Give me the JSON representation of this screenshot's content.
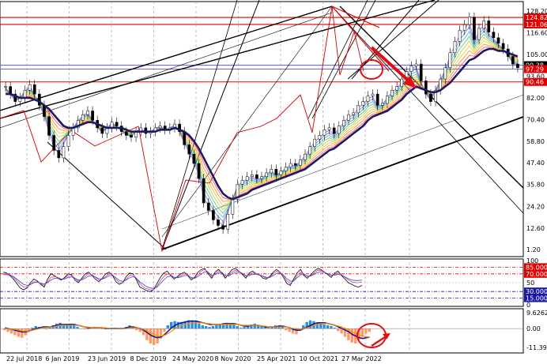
{
  "chart_data": [
    {
      "type": "candlestick",
      "title": "",
      "price_ticks": [
        "128.20",
        "116.60",
        "105.00",
        "93.60",
        "82.00",
        "70.40",
        "58.80",
        "47.40",
        "35.80",
        "24.20",
        "12.60",
        "1.20"
      ],
      "price_range": [
        1.2,
        128.2
      ],
      "tags": [
        {
          "label": "124.82",
          "value": 124.82,
          "color": "#e00000"
        },
        {
          "label": "121.06",
          "value": 121.06,
          "color": "#e00000"
        },
        {
          "label": "99.38",
          "value": 99.38,
          "color": "#000000"
        },
        {
          "label": "97.29",
          "value": 97.29,
          "color": "#e00000"
        },
        {
          "label": "90.46",
          "value": 90.46,
          "color": "#e00000"
        }
      ],
      "horizontal_lines": [
        {
          "value": 124.82,
          "color": "#e00000"
        },
        {
          "value": 121.06,
          "color": "#e00000"
        },
        {
          "value": 99.38,
          "color": "#6a6ad8"
        },
        {
          "value": 97.29,
          "color": "#6a6ad8"
        },
        {
          "value": 90.46,
          "color": "#e00000"
        }
      ],
      "series": [
        {
          "name": "",
          "type": "candles",
          "values": [
            88,
            84,
            80,
            82,
            86,
            89,
            84,
            78,
            72,
            62,
            54,
            50,
            56,
            62,
            66,
            70,
            73,
            75,
            70,
            66,
            63,
            66,
            69,
            67,
            64,
            62,
            61,
            64,
            66,
            63,
            64,
            66,
            67,
            65,
            66,
            68,
            64,
            57,
            52,
            47,
            39,
            26,
            22,
            17,
            14,
            12,
            20,
            28,
            36,
            38,
            40,
            41,
            39,
            40,
            42,
            44,
            41,
            43,
            45,
            47,
            46,
            49,
            52,
            56,
            60,
            62,
            65,
            66,
            63,
            67,
            70,
            73,
            74,
            78,
            80,
            83,
            84,
            78,
            79,
            83,
            86,
            88,
            92,
            96,
            99,
            100,
            91,
            84,
            80,
            86,
            92,
            98,
            106,
            112,
            118,
            121,
            125,
            113,
            119,
            123,
            117,
            114,
            111,
            108,
            104,
            100,
            98
          ]
        },
        {
          "name": "",
          "type": "moving-average",
          "color": "#1a1a6a",
          "values": [
            84,
            84,
            83,
            82,
            82,
            82,
            81,
            80,
            78,
            76,
            73,
            70,
            67,
            66,
            66,
            67,
            68,
            69,
            69,
            68,
            67,
            66,
            66,
            66,
            66,
            65,
            64,
            64,
            64,
            64,
            64,
            64,
            65,
            65,
            65,
            66,
            65,
            64,
            62,
            59,
            55,
            50,
            45,
            40,
            35,
            31,
            29,
            28,
            29,
            30,
            31,
            33,
            34,
            35,
            36,
            37,
            38,
            39,
            40,
            41,
            42,
            43,
            44,
            46,
            48,
            50,
            52,
            54,
            55,
            57,
            59,
            61,
            63,
            65,
            67,
            70,
            72,
            73,
            74,
            75,
            77,
            79,
            81,
            84,
            86,
            88,
            87,
            86,
            85,
            85,
            86,
            88,
            90,
            93,
            96,
            99,
            102,
            103,
            105,
            107,
            108,
            108,
            107,
            107,
            106,
            105,
            104
          ]
        }
      ]
    },
    {
      "type": "line",
      "title": "",
      "y_ticks": [
        "100",
        "85.0000",
        "70.0000",
        "50",
        "30.0000",
        "15.0000",
        "0"
      ],
      "y_range": [
        0,
        100
      ],
      "levels": [
        {
          "label": "85.0000",
          "value": 85,
          "color": "#e00000"
        },
        {
          "label": "70.0000",
          "value": 70,
          "color": "#e00000"
        },
        {
          "label": "30.0000",
          "value": 30,
          "color": "#1a1aa0"
        },
        {
          "label": "15.0000",
          "value": 15,
          "color": "#1a1aa0"
        }
      ],
      "series": [
        {
          "name": "",
          "color": "#000000",
          "values": [
            74,
            72,
            66,
            58,
            48,
            38,
            34,
            38,
            50,
            58,
            54,
            46,
            40,
            58,
            70,
            66,
            60,
            56,
            62,
            70,
            68,
            56,
            50,
            60,
            70,
            74,
            66,
            58,
            52,
            60,
            70,
            74,
            66,
            52,
            46,
            50,
            64,
            72,
            70,
            56,
            40,
            36,
            32,
            30,
            34,
            48,
            62,
            72,
            76,
            66,
            58,
            64,
            70,
            74,
            66,
            56,
            62,
            74,
            80,
            82,
            70,
            60,
            74,
            80,
            72,
            60,
            70,
            80,
            82,
            76,
            68,
            60,
            72,
            76,
            70,
            68,
            60,
            58,
            64,
            74,
            80,
            74,
            62,
            48,
            44,
            58,
            72,
            80,
            66,
            60,
            68,
            76,
            82,
            80,
            74,
            68,
            62,
            72,
            76,
            66,
            58,
            50,
            46,
            42,
            40,
            44
          ]
        },
        {
          "name": "",
          "color": "#d04090",
          "values": [
            70,
            70,
            68,
            62,
            54,
            46,
            40,
            40,
            46,
            52,
            52,
            48,
            44,
            52,
            62,
            64,
            62,
            58,
            60,
            66,
            66,
            60,
            54,
            58,
            64,
            70,
            68,
            62,
            56,
            58,
            64,
            70,
            68,
            58,
            50,
            50,
            58,
            66,
            68,
            60,
            48,
            40,
            36,
            34,
            34,
            42,
            54,
            64,
            70,
            68,
            62,
            62,
            66,
            70,
            68,
            60,
            60,
            68,
            76,
            80,
            74,
            64,
            70,
            76,
            74,
            64,
            66,
            74,
            78,
            76,
            70,
            64,
            68,
            72,
            70,
            68,
            64,
            60,
            62,
            70,
            76,
            74,
            66,
            54,
            48,
            54,
            66,
            74,
            70,
            64,
            66,
            72,
            78,
            78,
            74,
            70,
            66,
            68,
            72,
            68,
            62,
            56,
            52,
            50,
            50,
            52
          ]
        },
        {
          "name": "",
          "color": "#4040d0",
          "values": [
            68,
            68,
            67,
            64,
            58,
            52,
            46,
            44,
            46,
            50,
            51,
            49,
            47,
            50,
            56,
            60,
            60,
            58,
            58,
            62,
            63,
            60,
            56,
            56,
            60,
            65,
            66,
            63,
            59,
            58,
            61,
            66,
            66,
            61,
            55,
            53,
            56,
            61,
            64,
            60,
            52,
            46,
            41,
            38,
            37,
            40,
            48,
            56,
            63,
            65,
            62,
            61,
            63,
            66,
            66,
            62,
            60,
            64,
            70,
            75,
            73,
            67,
            68,
            72,
            72,
            67,
            65,
            70,
            74,
            74,
            71,
            66,
            66,
            69,
            69,
            67,
            65,
            62,
            62,
            66,
            71,
            72,
            67,
            59,
            53,
            54,
            61,
            68,
            68,
            65,
            65,
            69,
            73,
            75,
            73,
            70,
            67,
            67,
            69,
            67,
            63,
            59,
            56,
            55,
            55,
            56
          ]
        }
      ]
    },
    {
      "type": "histogram",
      "title": "",
      "y_ticks": [
        "9.6262",
        "0.00",
        "-11.3976"
      ],
      "y_range": [
        -11.3976,
        9.6262
      ],
      "dates": [
        "22 Jul 2018",
        "6 Jan 2019",
        "23 Jun 2019",
        "8 Dec 2019",
        "24 May 2020",
        "8 Nov 2020",
        "25 Apr 2021",
        "10 Oct 2021",
        "27 Mar 2022"
      ],
      "series": [
        {
          "name": "",
          "type": "bars",
          "values": [
            -1,
            -2,
            -3,
            -4,
            -5,
            -5.5,
            -4,
            -2,
            0.5,
            1.5,
            1,
            0.5,
            -0.5,
            1,
            2,
            3,
            3.5,
            2.5,
            2,
            3,
            2.5,
            1,
            0,
            -0.5,
            -0.5,
            0.5,
            1,
            0.5,
            0,
            -0.5,
            0,
            0.5,
            0.5,
            0,
            0,
            1,
            2,
            1,
            -1,
            -2,
            -4,
            -7,
            -9,
            -10,
            -9,
            -6,
            -2,
            2,
            4,
            4.5,
            4,
            4,
            4.5,
            5,
            5,
            4.5,
            3,
            2,
            1.5,
            1,
            1.5,
            2,
            2.5,
            3,
            3.5,
            3,
            2.5,
            1.5,
            0.5,
            1,
            2,
            2.5,
            3,
            2,
            1.5,
            1,
            0.5,
            1,
            2,
            2,
            1,
            -1,
            -2,
            -3,
            -3.5,
            -1,
            2,
            4,
            5,
            4.5,
            3.5,
            3,
            2.5,
            2,
            1.5,
            0.5,
            -1.5,
            -3,
            -5,
            -7,
            -8.5,
            -9,
            -7,
            -5,
            -3,
            -2
          ]
        },
        {
          "name": "",
          "type": "line",
          "color": "#1a1a8a",
          "values": [
            0.5,
            0,
            -0.5,
            -1,
            -1.5,
            -2,
            -2,
            -1.5,
            -0.5,
            0,
            0.5,
            1,
            1,
            1,
            1.5,
            2,
            2.5,
            2.5,
            2.5,
            2.5,
            2.5,
            2,
            1.5,
            1,
            0.5,
            0.5,
            0.5,
            0.5,
            0.5,
            0,
            0,
            0,
            0,
            0,
            0,
            0.5,
            1,
            1,
            0.5,
            0,
            -1,
            -2.5,
            -4,
            -5,
            -5.5,
            -5,
            -3.5,
            -1.5,
            0.5,
            2,
            3,
            3.5,
            4,
            4.5,
            4.5,
            4.5,
            4,
            3.5,
            3,
            2.5,
            2.5,
            2.5,
            2.5,
            3,
            3,
            3,
            3,
            2.5,
            2,
            1.5,
            1.5,
            2,
            2,
            2,
            1.5,
            1,
            1,
            1,
            1,
            1.5,
            1.5,
            1,
            0.5,
            -0.5,
            -1,
            -1,
            0,
            1,
            2,
            3,
            3.5,
            3.5,
            3.5,
            3,
            2.5,
            2,
            1,
            0,
            -1,
            -2,
            -3.5,
            -4.5,
            -5.5,
            -6,
            -5.5,
            -5
          ]
        },
        {
          "name": "",
          "type": "line",
          "color": "#ff8c00",
          "values": [
            0,
            0,
            -0.5,
            -0.5,
            -1,
            -1.5,
            -1.5,
            -1.5,
            -1,
            -0.5,
            0,
            0.5,
            0.5,
            1,
            1,
            1.5,
            2,
            2,
            2,
            2,
            2,
            2,
            1.5,
            1,
            1,
            0.5,
            0.5,
            0.5,
            0.5,
            0.5,
            0,
            0,
            0,
            0,
            0,
            0,
            0.5,
            0.5,
            0.5,
            0,
            -0.5,
            -1.5,
            -2.5,
            -3.5,
            -4.5,
            -4.5,
            -4,
            -3,
            -1.5,
            0,
            1,
            2,
            2.5,
            3,
            3.5,
            3.5,
            3.5,
            3.5,
            3,
            3,
            2.5,
            2.5,
            2.5,
            2.5,
            2.5,
            2.5,
            2.5,
            2.5,
            2,
            2,
            2,
            2,
            2,
            2,
            1.5,
            1.5,
            1,
            1,
            1,
            1,
            1,
            1,
            0.5,
            0,
            0,
            -0.5,
            0,
            0.5,
            1,
            2,
            2.5,
            3,
            3,
            3,
            2.5,
            2,
            1.5,
            1,
            0,
            -1,
            -2,
            -3,
            -4,
            -4.5,
            -5,
            -5
          ]
        }
      ]
    }
  ]
}
